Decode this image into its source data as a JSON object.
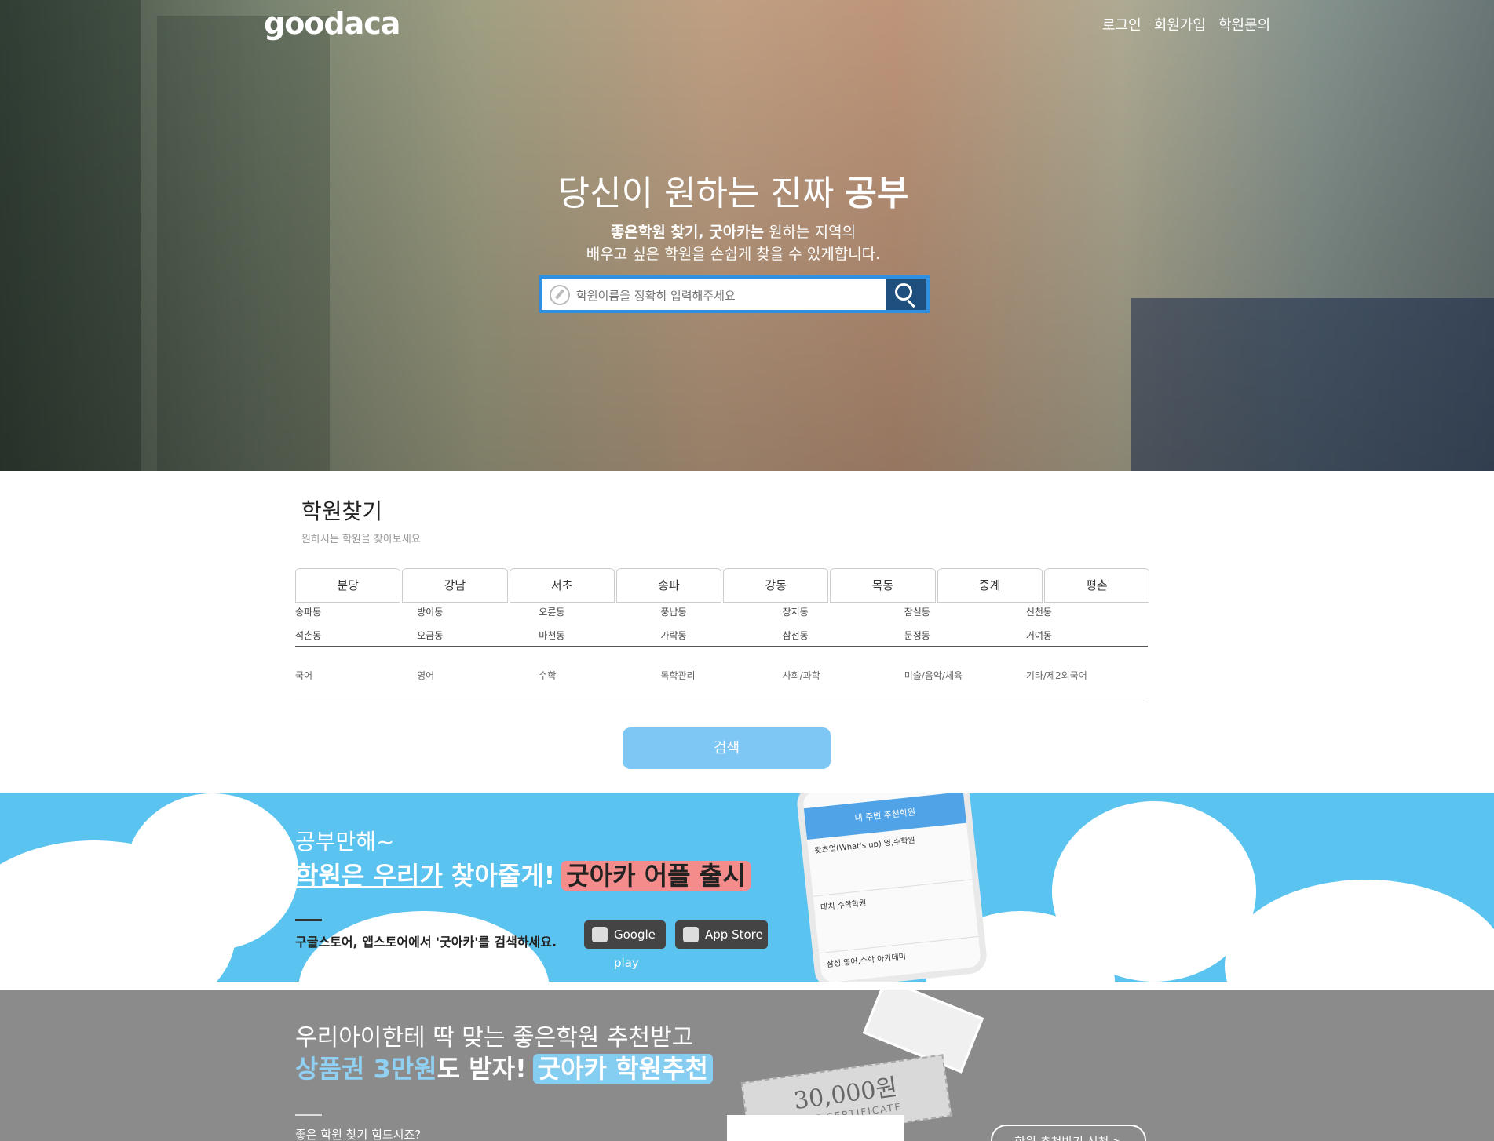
{
  "header": {
    "logo": "goodaca",
    "nav": [
      "로그인",
      "회원가입",
      "학원문의"
    ]
  },
  "hero": {
    "headline_prefix": "당신이 원하는 진짜 ",
    "headline_bold": "공부",
    "sub1_bold1": "좋은학원 찾기, ",
    "sub1_bold2": "굿아카는",
    "sub1_rest": " 원하는 지역의",
    "sub2": "배우고 싶은 학원을 손쉽게 찾을 수 있게합니다.",
    "search_placeholder": "학원이름을 정확히 입력해주세요"
  },
  "finder": {
    "title": "학원찾기",
    "subtitle": "원하시는 학원을 찾아보세요",
    "regions": [
      "분당",
      "강남",
      "서초",
      "송파",
      "강동",
      "목동",
      "중계",
      "평촌"
    ],
    "dong_rows": [
      [
        "송파동",
        "방이동",
        "오륜동",
        "풍납동",
        "장지동",
        "잠실동",
        "신천동"
      ],
      [
        "석촌동",
        "오금동",
        "마천동",
        "가락동",
        "삼전동",
        "문정동",
        "거여동"
      ]
    ],
    "subjects": [
      "국어",
      "영어",
      "수학",
      "독학관리",
      "사회/과학",
      "미술/음악/체육",
      "기타/제2외국어"
    ],
    "search_button": "검색"
  },
  "app_banner": {
    "line1": "공부만해~",
    "line2_underline": "학원은 우리가",
    "line2_rest": " 찾아줄게!",
    "line2_pill": "굿아카 어플 출시",
    "line3": "구글스토어, 앱스토어에서 '굿아카'를 검색하세요.",
    "store_google": "Google play",
    "store_apple": "App Store",
    "phone_title": "내 주변 추천학원",
    "phone_items": [
      "왓츠업(What's up) 영,수학원",
      "대치 수학학원",
      "삼성 영어,수학 아카데미"
    ]
  },
  "gift_banner": {
    "line1": "우리아이한테 딱 맞는 좋은학원 추천받고",
    "line2_blue": "상품권 3만원",
    "line2_rest": "도 받자!",
    "line2_pill": "굿아카 학원추천",
    "line3": "좋은 학원 찾기 힘드시죠?",
    "ticket_amount": "30,000원",
    "ticket_label": "GIFT CERTIFICATE",
    "apply_button": "학원 추천받기 신청 >"
  }
}
